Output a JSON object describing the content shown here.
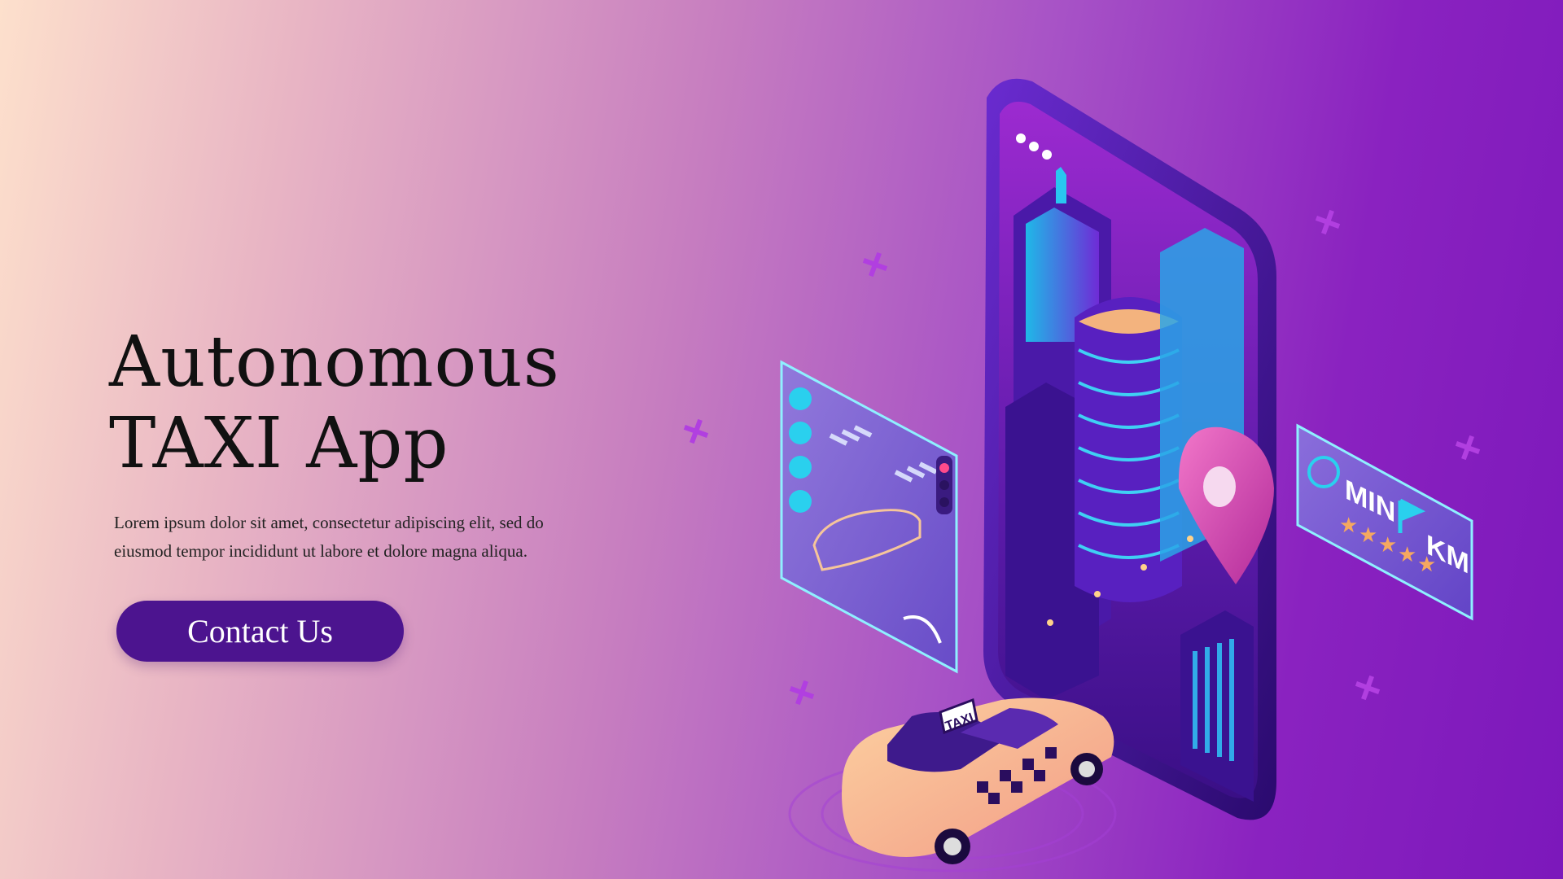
{
  "hero": {
    "title_line1": "Autonomous",
    "title_line2": "TAXI App",
    "description": "Lorem ipsum dolor sit amet, consectetur adipiscing elit, sed do eiusmod tempor incididunt ut labore et dolore magna aliqua.",
    "cta_label": "Contact Us"
  },
  "illustration": {
    "taxi_sign": "TAXI",
    "info_panel": {
      "time_label": "MIN",
      "distance_label": "KM",
      "rating_stars": 5
    },
    "icons": [
      "navigation-arrow-icon",
      "location-pin-icon",
      "zoom-in-icon",
      "zoom-out-icon",
      "traffic-light-icon",
      "speedometer-icon",
      "clock-icon",
      "flag-icon",
      "star-icon",
      "map-pin-icon",
      "menu-dots-icon"
    ]
  },
  "colors": {
    "accent": "#4c148f",
    "background_start": "#fde0cc",
    "background_end": "#7c18bb",
    "pin": "#e04fb0",
    "taxi": "#f6b98a"
  }
}
